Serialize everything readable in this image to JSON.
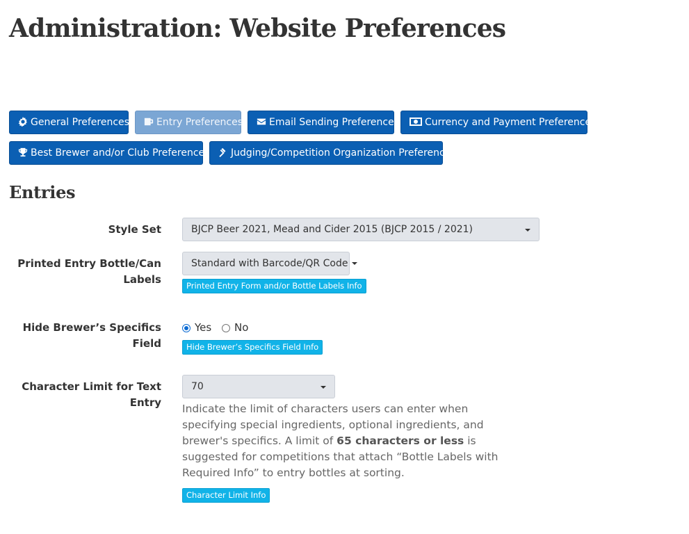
{
  "page": {
    "title": "Administration: Website Preferences"
  },
  "nav": {
    "buttons": [
      {
        "label": "General Preferences",
        "icon": "gear-icon"
      },
      {
        "label": "Entry Preferences",
        "icon": "beer-mug-icon",
        "active": true
      },
      {
        "label": "Email Sending Preferences",
        "icon": "envelope-icon"
      },
      {
        "label": "Currency and Payment Preferences",
        "icon": "money-bill-icon"
      },
      {
        "label": "Best Brewer and/or Club Preferences",
        "icon": "trophy-icon"
      },
      {
        "label": "Judging/Competition Organization Preferences",
        "icon": "gavel-icon"
      }
    ]
  },
  "section": {
    "title": "Entries"
  },
  "fields": {
    "style_set": {
      "label": "Style Set",
      "value": "BJCP Beer 2021, Mead and Cider 2015 (BJCP 2015 / 2021)"
    },
    "labels": {
      "label_line1": "Printed Entry Bottle/Can",
      "label_line2": "Labels",
      "value": "Standard with Barcode/QR Code",
      "info": "Printed Entry Form and/or Bottle Labels Info"
    },
    "hide_specifics": {
      "label": "Hide Brewer’s Specifics Field",
      "yes": "Yes",
      "no": "No",
      "selected": "Yes",
      "info": "Hide Brewer’s Specifics Field Info"
    },
    "char_limit": {
      "label": "Character Limit for Text Entry",
      "value": "70",
      "help_1": "Indicate the limit of characters users can enter when specifying special ingredients, optional ingredients, and brewer's specifics. A limit of ",
      "help_bold": "65 characters or less",
      "help_2": " is suggested for competitions that attach “Bottle Labels with Required Info” to entry bottles at sorting.",
      "info": "Character Limit Info"
    }
  },
  "colors": {
    "primary": "#0b5fb3",
    "primary_active": "#7ba6d4",
    "info": "#11b3e8",
    "select_bg": "#e2e5ea"
  }
}
